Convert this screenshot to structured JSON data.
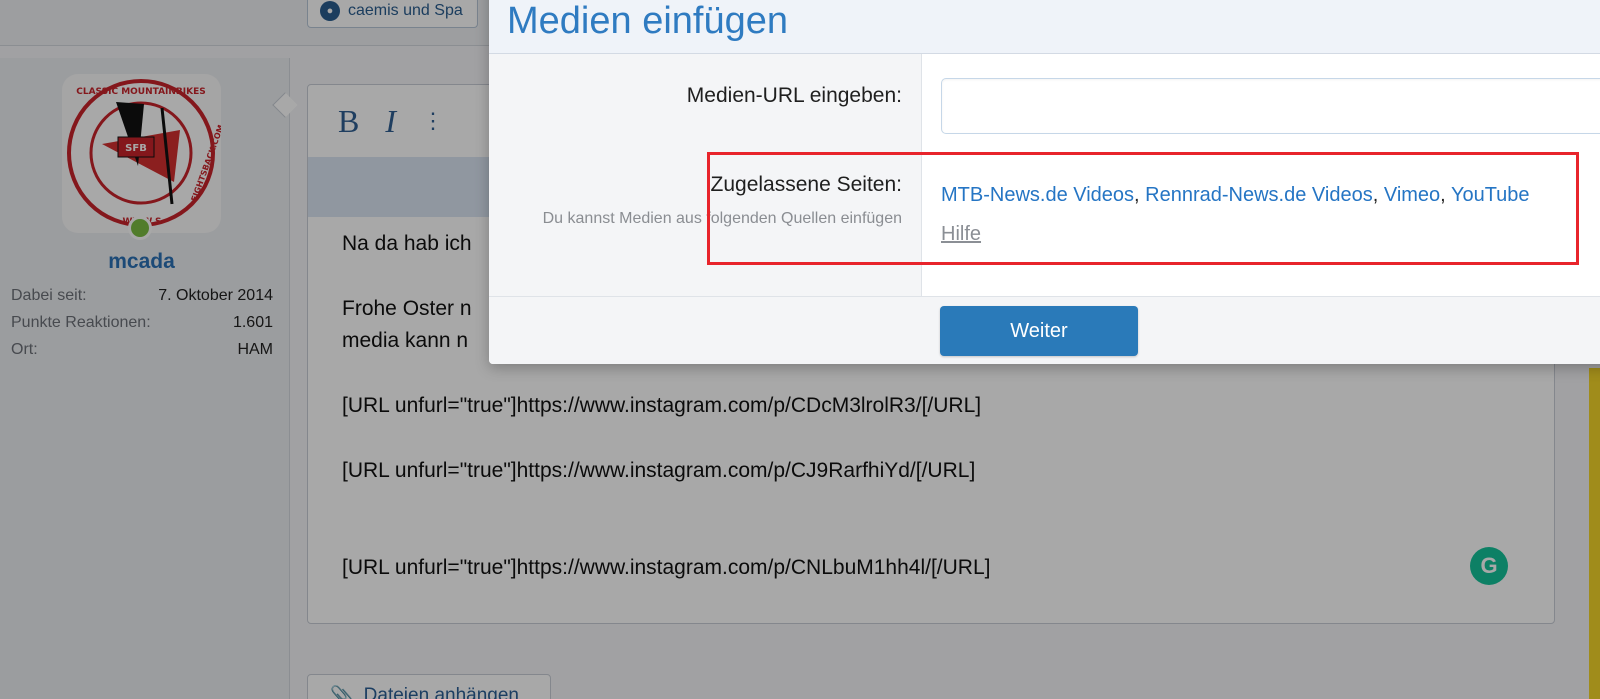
{
  "top_tag": {
    "label": "caemis und Spa"
  },
  "user": {
    "name": "mcada",
    "stats": [
      {
        "label": "Dabei seit:",
        "value": "7. Oktober 2014"
      },
      {
        "label": "Punkte Reaktionen:",
        "value": "1.601"
      },
      {
        "label": "Ort:",
        "value": "HAM"
      }
    ],
    "avatar_text_top": "CLASSIC MOUNTAINBIKES",
    "avatar_text_right": "FIGHTSBACK.COM",
    "avatar_text_bottom": "WWW.S",
    "avatar_center": "SFB"
  },
  "editor": {
    "toolbar": {
      "bold": "B",
      "italic": "I",
      "more": "⋮"
    },
    "lines": [
      "Na da hab ich",
      "Frohe Oster n",
      "media kann n",
      "[URL unfurl=\"true\"]https://www.instagram.com/p/CDcM3lrolR3/[/URL]",
      "[URL unfurl=\"true\"]https://www.instagram.com/p/CJ9RarfhiYd/[/URL]",
      "[URL unfurl=\"true\"]https://www.instagram.com/p/CNLbuM1hh4l/[/URL]"
    ],
    "grammarly_icon": "G"
  },
  "attach_button": {
    "label": "Dateien anhängen"
  },
  "modal": {
    "title": "Medien einfügen",
    "url_label": "Medien-URL eingeben:",
    "url_value": "",
    "sites_label": "Zugelassene Seiten:",
    "sites_hint": "Du kannst Medien aus folgenden Quellen einfügen",
    "sites": [
      "MTB-News.de Videos",
      "Rennrad-News.de Videos",
      "Vimeo",
      "YouTube"
    ],
    "help_label": "Hilfe",
    "submit_label": "Weiter"
  },
  "colors": {
    "accent": "#2a7ab9",
    "link": "#2575c4",
    "username": "#2b71b5",
    "highlight": "#e8242b",
    "online": "#7bbd42",
    "grammarly": "#15c39a"
  }
}
